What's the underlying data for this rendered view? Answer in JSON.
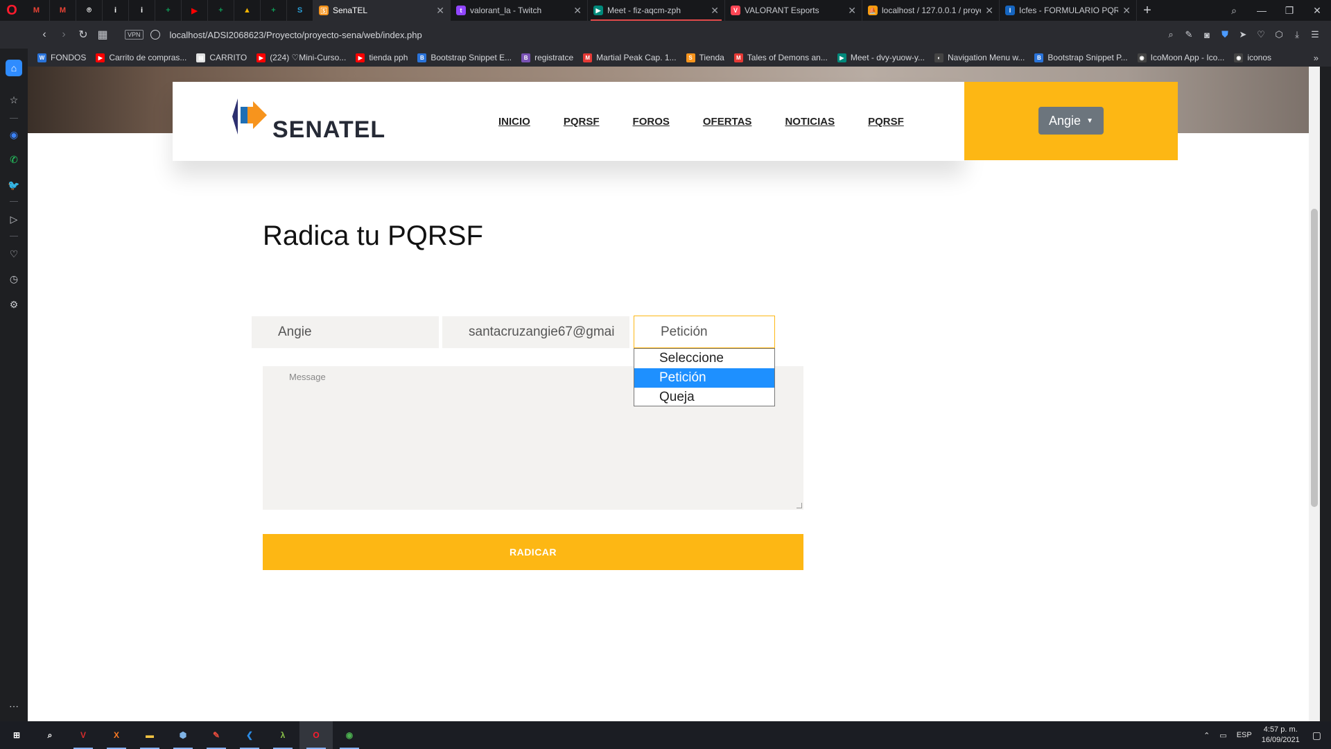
{
  "browser": {
    "pinned_tabs": [
      {
        "icon": "gmail-icon",
        "letter": "M",
        "color": "#ea4335"
      },
      {
        "icon": "gmail-icon",
        "letter": "M",
        "color": "#ea4335"
      },
      {
        "icon": "github-icon",
        "letter": "⌾",
        "color": "#ffffff"
      },
      {
        "icon": "info-icon",
        "letter": "i",
        "color": "#ffffff"
      },
      {
        "icon": "info-icon",
        "letter": "i",
        "color": "#ffffff"
      },
      {
        "icon": "classroom-icon",
        "letter": "+",
        "color": "#0f9d58"
      },
      {
        "icon": "youtube-icon",
        "letter": "▶",
        "color": "#ff0000"
      },
      {
        "icon": "classroom-icon",
        "letter": "+",
        "color": "#0f9d58"
      },
      {
        "icon": "drive-icon",
        "letter": "▲",
        "color": "#f4b400"
      },
      {
        "icon": "classroom-icon",
        "letter": "+",
        "color": "#0f9d58"
      },
      {
        "icon": "s-icon",
        "letter": "S",
        "color": "#2a9ed6"
      }
    ],
    "tabs": [
      {
        "title": "SenaTEL",
        "color": "#f7941d",
        "letter": "🅂"
      },
      {
        "title": "valorant_la - Twitch",
        "color": "#9146ff",
        "letter": "t"
      },
      {
        "title": "Meet - fiz-aqcm-zph",
        "color": "#00897b",
        "letter": "▶"
      },
      {
        "title": "VALORANT Esports",
        "color": "#ff4655",
        "letter": "V"
      },
      {
        "title": "localhost / 127.0.0.1 / proye",
        "color": "#f89c0e",
        "letter": "⛵"
      },
      {
        "title": "Icfes - FORMULARIO PQRSF",
        "color": "#1565c0",
        "letter": "I"
      }
    ],
    "url": "localhost/ADSI2068623/Proyecto/proyecto-sena/web/index.php",
    "vpn_label": "VPN",
    "bookmarks": [
      {
        "label": "FONDOS",
        "color": "#2a73d9",
        "letter": "W"
      },
      {
        "label": "Carrito de compras...",
        "color": "#ff0000",
        "letter": "▶"
      },
      {
        "label": "CARRITO",
        "color": "#e0e0e0",
        "letter": "▤"
      },
      {
        "label": "(224) ♡Mini-Curso...",
        "color": "#ff0000",
        "letter": "▶"
      },
      {
        "label": "tienda pph",
        "color": "#ff0000",
        "letter": "▶"
      },
      {
        "label": "Bootstrap Snippet E...",
        "color": "#2a73d9",
        "letter": "B"
      },
      {
        "label": "registratce",
        "color": "#7952b3",
        "letter": "B"
      },
      {
        "label": "Martial Peak Cap. 1...",
        "color": "#e53935",
        "letter": "M"
      },
      {
        "label": "Tienda",
        "color": "#f7941d",
        "letter": "S"
      },
      {
        "label": "Tales of Demons an...",
        "color": "#e53935",
        "letter": "M"
      },
      {
        "label": "Meet - dvy-yuow-y...",
        "color": "#00897b",
        "letter": "▶"
      },
      {
        "label": "Navigation Menu w...",
        "color": "#444444",
        "letter": "◐"
      },
      {
        "label": "Bootstrap Snippet P...",
        "color": "#2a73d9",
        "letter": "B"
      },
      {
        "label": "IcoMoon App - Ico...",
        "color": "#444444",
        "letter": "◉"
      },
      {
        "label": "iconos",
        "color": "#444444",
        "letter": "◉"
      }
    ]
  },
  "site": {
    "brand": "SENATEL",
    "menu": [
      "INICIO",
      "PQRSF",
      "FOROS",
      "OFERTAS",
      "NOTICIAS",
      "PQRSF"
    ],
    "user_button": "Angie",
    "accent_color": "#fdb714",
    "page_title": "Radica tu PQRSF",
    "form": {
      "name_value": "Angie",
      "email_value": "santacruzangie67@gmai",
      "type_value": "Petición",
      "type_options": [
        "Seleccione",
        "Petición",
        "Queja"
      ],
      "type_selected_index": 1,
      "message_placeholder": "Message",
      "submit_label": "RADICAR"
    }
  },
  "taskbar": {
    "apps": [
      {
        "icon": "windows-start-icon"
      },
      {
        "icon": "search-icon"
      },
      {
        "icon": "vivaldi-icon"
      },
      {
        "icon": "xampp-icon"
      },
      {
        "icon": "file-explorer-icon"
      },
      {
        "icon": "box-icon"
      },
      {
        "icon": "paint-icon"
      },
      {
        "icon": "vscode-icon"
      },
      {
        "icon": "lambda-icon"
      },
      {
        "icon": "opera-icon"
      },
      {
        "icon": "chrome-icon"
      }
    ],
    "language": "ESP",
    "time": "4:57 p. m.",
    "date": "16/09/2021"
  }
}
